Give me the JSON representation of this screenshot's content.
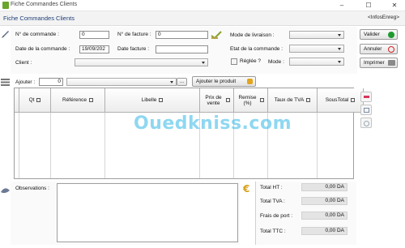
{
  "window": {
    "title": "Fiche Commandes Clients",
    "controls": [
      "–",
      "☐",
      "✕"
    ]
  },
  "header": {
    "title": "Fiche Commandes Clients",
    "info": "<InfosEnreg>"
  },
  "form": {
    "num_commande_label": "N° de commande :",
    "num_commande_value": "0",
    "num_facture_label": "N° de facture :",
    "num_facture_value": "0",
    "date_commande_label": "Date de la commande :",
    "date_commande_value": "19/09/202",
    "date_facture_label": "Date facture :",
    "date_facture_value": "",
    "client_label": "Client :",
    "client_value": "",
    "mode_livraison_label": "Mode de livraison :",
    "mode_livraison_value": "",
    "etat_commande_label": "Etat de la commande :",
    "etat_commande_value": "",
    "reglee_label": "Réglée ?",
    "mode_label": "Mode :",
    "mode_value": ""
  },
  "actions": {
    "valider": "Valider",
    "annuler": "Annuler",
    "imprimer": "Imprimer"
  },
  "add": {
    "label": "Ajouter :",
    "qty": "0",
    "product_value": "",
    "ellipsis": "...",
    "add_button": "Ajouter le produit"
  },
  "table": {
    "columns": [
      "Qt",
      "Référence",
      "Libelle",
      "Prix de vente",
      "Remise (%)",
      "Taux de TVA",
      "SousTotal"
    ]
  },
  "observations_label": "Observations :",
  "totals": {
    "ht_label": "Total HT :",
    "ht_value": "0,00 DA",
    "tva_label": "Total TVA :",
    "tva_value": "0,00 DA",
    "port_label": "Frais de port :",
    "port_value": "0,00 DA",
    "ttc_label": "Total TTC :",
    "ttc_value": "0,00 DA"
  },
  "watermark": "Ouedkniss.com",
  "colors": {
    "accent_title": "#1e3e78",
    "valider_green": "#1f9a2f",
    "annuler_red": "#d32020",
    "watermark_blue": "#34b8e6"
  }
}
